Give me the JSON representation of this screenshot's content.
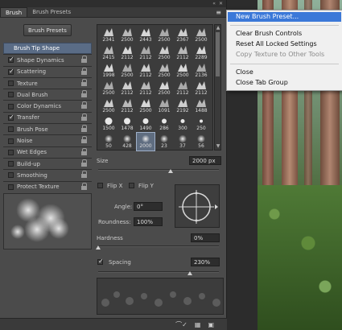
{
  "panel": {
    "title_controls": [
      "«",
      "✕"
    ],
    "tabs": [
      {
        "label": "Brush",
        "active": true
      },
      {
        "label": "Brush Presets",
        "active": false
      }
    ],
    "brush_presets_button": "Brush Presets",
    "options": [
      {
        "label": "Brush Tip Shape",
        "header": true
      },
      {
        "label": "Shape Dynamics",
        "checked": true,
        "lock": true
      },
      {
        "label": "Scattering",
        "checked": true,
        "lock": true
      },
      {
        "label": "Texture",
        "checked": false,
        "lock": true
      },
      {
        "label": "Dual Brush",
        "checked": false,
        "lock": true
      },
      {
        "label": "Color Dynamics",
        "checked": false,
        "lock": true
      },
      {
        "label": "Transfer",
        "checked": true,
        "lock": true
      },
      {
        "label": "Brush Pose",
        "checked": false,
        "lock": true
      },
      {
        "label": "Noise",
        "checked": false,
        "lock": true
      },
      {
        "label": "Wet Edges",
        "checked": false,
        "lock": true
      },
      {
        "label": "Build-up",
        "checked": false,
        "lock": true
      },
      {
        "label": "Smoothing",
        "checked": false,
        "lock": true
      },
      {
        "label": "Protect Texture",
        "checked": false,
        "lock": true
      }
    ],
    "brush_sizes": [
      [
        "2341",
        "2500",
        "2443",
        "2500",
        "2367",
        "2500"
      ],
      [
        "2415",
        "2112",
        "2112",
        "2500",
        "2112",
        "2289"
      ],
      [
        "1998",
        "2500",
        "2112",
        "2500",
        "2500",
        "2136"
      ],
      [
        "2500",
        "2112",
        "2112",
        "2500",
        "2112",
        "2112"
      ],
      [
        "2500",
        "2112",
        "2500",
        "1091",
        "2192",
        "1488"
      ],
      [
        "1500",
        "1478",
        "1490",
        "286",
        "300",
        "250"
      ],
      [
        "50",
        "428",
        "2000",
        "23",
        "37",
        "56"
      ]
    ],
    "selected_brush": "2000",
    "size": {
      "label": "Size",
      "value": "2000 px",
      "slider": 0.6
    },
    "flip_x": {
      "label": "Flip X",
      "checked": false
    },
    "flip_y": {
      "label": "Flip Y",
      "checked": false
    },
    "angle": {
      "label": "Angle:",
      "value": "0°"
    },
    "roundness": {
      "label": "Roundness:",
      "value": "100%"
    },
    "hardness": {
      "label": "Hardness",
      "value": "0%",
      "slider": 0.0
    },
    "spacing": {
      "label": "Spacing",
      "value": "230%",
      "checked": true,
      "slider": 0.76
    },
    "bottom_icons": [
      "eye-brush-icon",
      "create-preset-icon",
      "panel-menu-icon"
    ]
  },
  "menu": {
    "items": [
      {
        "label": "New Brush Preset...",
        "highlighted": true,
        "enabled": true
      },
      {
        "label": "Clear Brush Controls",
        "enabled": true
      },
      {
        "label": "Reset All Locked Settings",
        "enabled": true
      },
      {
        "label": "Copy Texture to Other Tools",
        "enabled": false
      },
      {
        "label": "Close",
        "enabled": true
      },
      {
        "label": "Close Tab Group",
        "enabled": true
      }
    ]
  },
  "colors": {
    "accent": "#3b78d8",
    "header_row": "#5a6c86",
    "panel_bg": "#4b4b4b"
  }
}
